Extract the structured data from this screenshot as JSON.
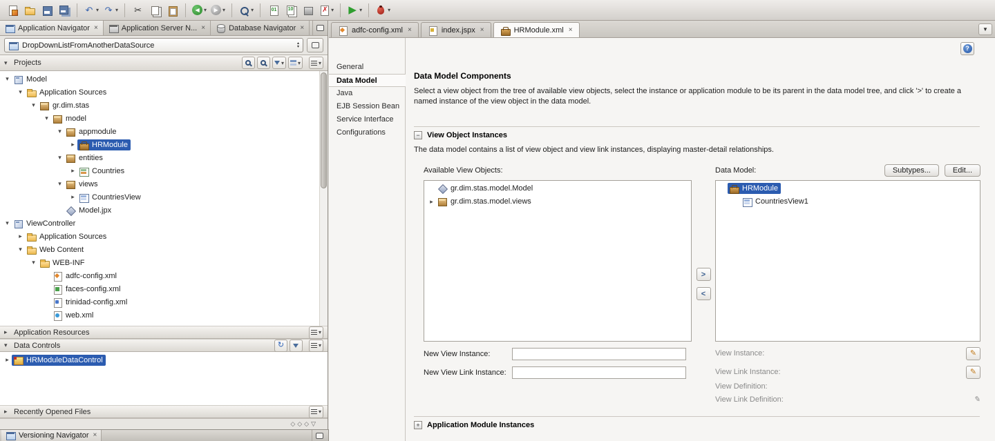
{
  "toolbar": {
    "groups": [
      [
        {
          "id": "new-file"
        },
        {
          "id": "open-file"
        },
        {
          "id": "save"
        },
        {
          "id": "save-all"
        }
      ],
      [
        {
          "id": "undo",
          "dropdown": true
        },
        {
          "id": "redo",
          "dropdown": true
        }
      ],
      [
        {
          "id": "cut"
        },
        {
          "id": "copy"
        },
        {
          "id": "paste"
        }
      ],
      [
        {
          "id": "back",
          "dropdown": true
        },
        {
          "id": "forward",
          "dropdown": true
        }
      ],
      [
        {
          "id": "search-user",
          "dropdown": true
        }
      ],
      [
        {
          "id": "make"
        },
        {
          "id": "rebuild"
        },
        {
          "id": "deploy"
        },
        {
          "id": "audit",
          "dropdown": true
        }
      ],
      [
        {
          "id": "run",
          "dropdown": true
        }
      ],
      [
        {
          "id": "debug",
          "dropdown": true
        }
      ]
    ]
  },
  "navigator": {
    "tabs": [
      {
        "label": "Application Navigator",
        "icon": "app-navigator",
        "active": true
      },
      {
        "label": "Application Server N...",
        "icon": "app-server",
        "active": false
      },
      {
        "label": "Database Navigator",
        "icon": "database",
        "active": false
      }
    ],
    "app_selector": {
      "value": "DropDownListFromAnotherDataSource"
    },
    "sections": {
      "projects": {
        "title": "Projects"
      },
      "app_resources": {
        "title": "Application Resources"
      },
      "data_controls": {
        "title": "Data Controls"
      },
      "recent_files": {
        "title": "Recently Opened Files"
      }
    },
    "projects_tree": [
      {
        "label": "Model",
        "level": 0,
        "expand": "open",
        "icon": "project"
      },
      {
        "label": "Application Sources",
        "level": 1,
        "expand": "open",
        "icon": "folder"
      },
      {
        "label": "gr.dim.stas",
        "level": 2,
        "expand": "open",
        "icon": "package"
      },
      {
        "label": "model",
        "level": 3,
        "expand": "open",
        "icon": "package"
      },
      {
        "label": "appmodule",
        "level": 4,
        "expand": "open",
        "icon": "package"
      },
      {
        "label": "HRModule",
        "level": 5,
        "expand": "closed",
        "icon": "appmodule",
        "selected": true
      },
      {
        "label": "entities",
        "level": 4,
        "expand": "open",
        "icon": "package"
      },
      {
        "label": "Countries",
        "level": 5,
        "expand": "closed",
        "icon": "entity"
      },
      {
        "label": "views",
        "level": 4,
        "expand": "open",
        "icon": "package"
      },
      {
        "label": "CountriesView",
        "level": 5,
        "expand": "closed",
        "icon": "view"
      },
      {
        "label": "Model.jpx",
        "level": 4,
        "expand": "none",
        "icon": "jpx"
      },
      {
        "label": "ViewController",
        "level": 0,
        "expand": "open",
        "icon": "project"
      },
      {
        "label": "Application Sources",
        "level": 1,
        "expand": "closed",
        "icon": "folder"
      },
      {
        "label": "Web Content",
        "level": 1,
        "expand": "open",
        "icon": "folder"
      },
      {
        "label": "WEB-INF",
        "level": 2,
        "expand": "open",
        "icon": "folder"
      },
      {
        "label": "adfc-config.xml",
        "level": 3,
        "expand": "none",
        "icon": "adfc-file"
      },
      {
        "label": "faces-config.xml",
        "level": 3,
        "expand": "none",
        "icon": "faces-file"
      },
      {
        "label": "trinidad-config.xml",
        "level": 3,
        "expand": "none",
        "icon": "xml-file"
      },
      {
        "label": "web.xml",
        "level": 3,
        "expand": "none",
        "icon": "web-file"
      }
    ],
    "data_controls_tree": [
      {
        "label": "HRModuleDataControl",
        "level": 0,
        "expand": "closed",
        "icon": "data-control",
        "selected": true
      }
    ],
    "footer_glyphs": "◇◇◇▽",
    "bottom_tab": {
      "label": "Versioning Navigator",
      "icon": "versioning"
    }
  },
  "editor": {
    "tabs": [
      {
        "label": "adfc-config.xml",
        "icon": "adfc-file",
        "active": false
      },
      {
        "label": "index.jspx",
        "icon": "jspx-file",
        "active": false
      },
      {
        "label": "HRModule.xml",
        "icon": "appmodule",
        "active": true
      }
    ],
    "help_label": "?",
    "nav": [
      {
        "label": "General",
        "active": false
      },
      {
        "label": "Data Model",
        "active": true
      },
      {
        "label": "Java",
        "active": false
      },
      {
        "label": "EJB Session Bean",
        "active": false
      },
      {
        "label": "Service Interface",
        "active": false
      },
      {
        "label": "Configurations",
        "active": false
      }
    ],
    "content": {
      "title": "Data Model Components",
      "description": "Select a view object from the tree of available view objects, select the instance or application module to be its parent in the data model tree, and click '>' to create a named instance of the view object in the data model.",
      "section_view_objects": {
        "title": "View Object Instances",
        "subtitle": "The data model contains a list of view object and view link instances, displaying master-detail relationships."
      },
      "available_label": "Available View Objects:",
      "data_model_label": "Data Model:",
      "subtypes_button": "Subtypes...",
      "edit_button": "Edit...",
      "available_tree": [
        {
          "label": "gr.dim.stas.model.Model",
          "level": 0,
          "expand": "none",
          "icon": "model-node"
        },
        {
          "label": "gr.dim.stas.model.views",
          "level": 0,
          "expand": "closed",
          "icon": "package"
        }
      ],
      "data_model_tree": [
        {
          "label": "HRModule",
          "level": 0,
          "expand": "none",
          "icon": "appmodule",
          "selected": true
        },
        {
          "label": "CountriesView1",
          "level": 1,
          "expand": "none",
          "icon": "view-instance"
        }
      ],
      "move_right": ">",
      "move_left": "<",
      "fields": {
        "new_view_instance": "New View Instance:",
        "new_view_instance_value": "",
        "new_view_link_instance": "New View Link Instance:",
        "new_view_link_instance_value": "",
        "view_instance": "View Instance:",
        "view_link_instance": "View Link Instance:",
        "view_definition": "View Definition:",
        "view_link_definition": "View Link Definition:"
      },
      "section_am_instances": {
        "title": "Application Module Instances"
      }
    }
  }
}
